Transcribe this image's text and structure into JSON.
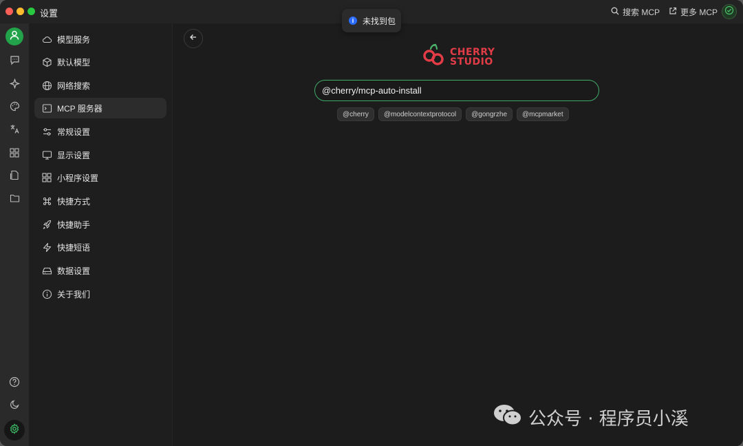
{
  "window": {
    "title": "设置"
  },
  "titlebar": {
    "search_mcp": "搜索 MCP",
    "more_mcp": "更多 MCP"
  },
  "toast": {
    "text": "未找到包"
  },
  "sidebar_menu": [
    {
      "label": "模型服务",
      "icon": "cloud-icon"
    },
    {
      "label": "默认模型",
      "icon": "cube-icon"
    },
    {
      "label": "网络搜索",
      "icon": "globe-icon"
    },
    {
      "label": "MCP 服务器",
      "icon": "terminal-icon",
      "active": true
    },
    {
      "label": "常规设置",
      "icon": "sliders-icon"
    },
    {
      "label": "显示设置",
      "icon": "monitor-icon"
    },
    {
      "label": "小程序设置",
      "icon": "grid-icon"
    },
    {
      "label": "快捷方式",
      "icon": "command-icon"
    },
    {
      "label": "快捷助手",
      "icon": "rocket-icon"
    },
    {
      "label": "快捷短语",
      "icon": "zap-icon"
    },
    {
      "label": "数据设置",
      "icon": "hard-drive-icon"
    },
    {
      "label": "关于我们",
      "icon": "info-icon"
    }
  ],
  "logo": {
    "line1": "CHERRY",
    "line2": "STUDIO",
    "color": "#e23c47"
  },
  "search": {
    "value": "@cherry/mcp-auto-install",
    "accent": "#3fae6a"
  },
  "tags": [
    "@cherry",
    "@modelcontextprotocol",
    "@gongrzhe",
    "@mcpmarket"
  ],
  "watermark": {
    "text": "公众号 · 程序员小溪"
  }
}
